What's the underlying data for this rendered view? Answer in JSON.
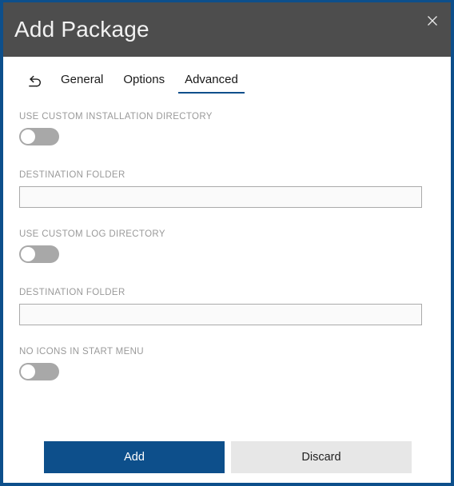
{
  "window": {
    "title": "Add Package",
    "close_icon": "close-icon",
    "accent_color": "#0d4f8b",
    "titlebar_color": "#4d4d4d"
  },
  "tabs": {
    "back_icon": "undo-arrow-icon",
    "items": [
      {
        "label": "General",
        "active": false
      },
      {
        "label": "Options",
        "active": false
      },
      {
        "label": "Advanced",
        "active": true
      }
    ]
  },
  "fields": {
    "use_custom_installation_directory": {
      "label": "USE CUSTOM INSTALLATION DIRECTORY",
      "state": "off"
    },
    "installation_destination_folder": {
      "label": "DESTINATION FOLDER",
      "value": "",
      "placeholder": ""
    },
    "use_custom_log_directory": {
      "label": "USE CUSTOM LOG DIRECTORY",
      "state": "off"
    },
    "log_destination_folder": {
      "label": "DESTINATION FOLDER",
      "value": "",
      "placeholder": ""
    },
    "no_icons_in_start_menu": {
      "label": "NO ICONS IN START MENU",
      "state": "off"
    }
  },
  "footer": {
    "add_label": "Add",
    "discard_label": "Discard"
  }
}
